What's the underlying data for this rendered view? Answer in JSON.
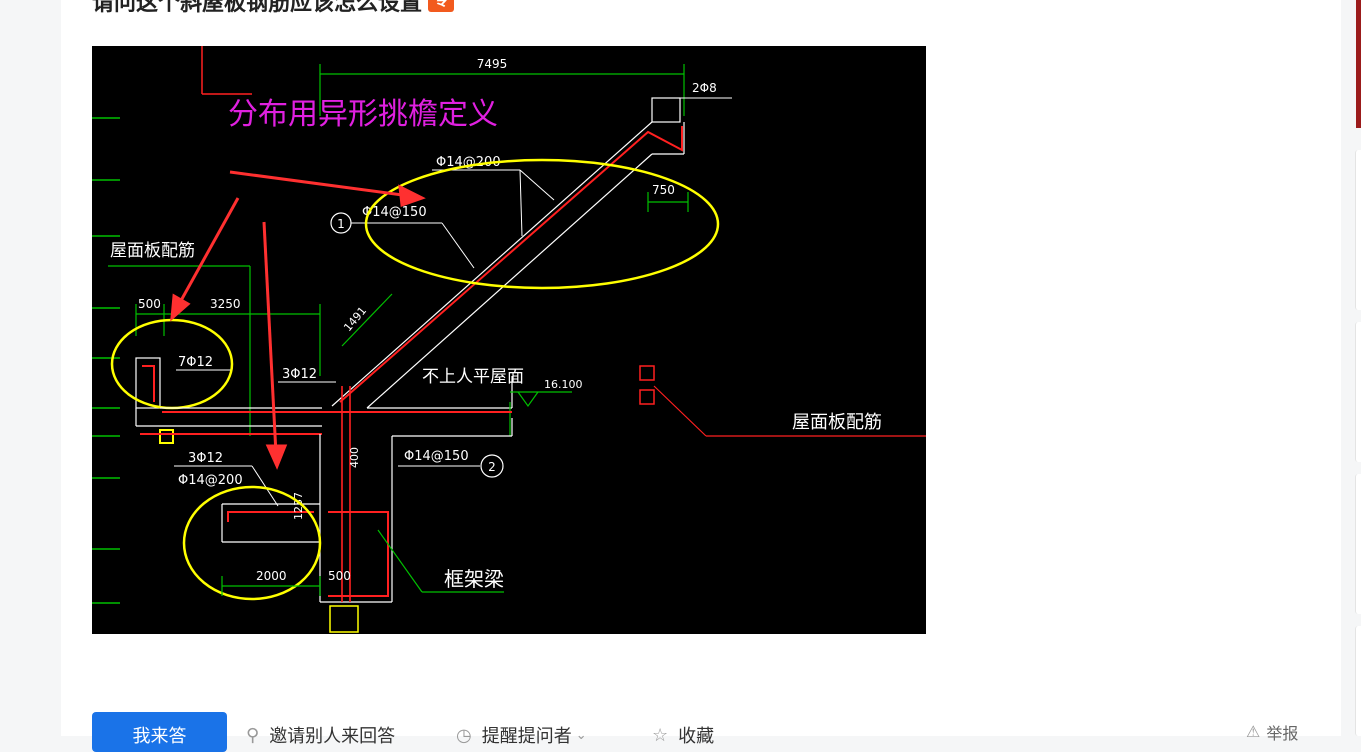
{
  "question": {
    "title": "请问这个斜屋板钢筋应该怎么设置",
    "badge": "专"
  },
  "image": {
    "annotation_title": "分布用异形挑檐定义",
    "dims": {
      "top_span": "7495",
      "top_right": "2Φ8",
      "rebar_top": "Φ14@200",
      "rebar_slope": "Φ14@150",
      "dim_750": "750",
      "roof_label_left": "屋面板配筋",
      "dim_500_left": "500",
      "dim_3250": "3250",
      "dim_1491": "1491",
      "rebar_7phi12": "7Φ12",
      "rebar_3phi12_mid": "3Φ12",
      "flat_roof_label": "不上人平屋面",
      "elevation": "16.100",
      "roof_label_right": "屋面板配筋",
      "rebar_3phi12_low": "3Φ12",
      "rebar_phi14_200_low": "Φ14@200",
      "rebar_phi14_150_low": "Φ14@150",
      "dim_1237": "1237",
      "dim_400": "400",
      "dim_2000": "2000",
      "dim_500_bottom": "500",
      "frame_beam_label": "框架梁",
      "circle_1": "1",
      "circle_2": "2"
    }
  },
  "actions": {
    "answer_label": "我来答",
    "invite_label": "邀请别人来回答",
    "remind_label": "提醒提问者",
    "collect_label": "收藏",
    "report_label": "举报"
  },
  "colors": {
    "primary": "#1a73e8",
    "badge": "#f25a1e",
    "cad_bg": "#000000",
    "cad_red": "#ff2020",
    "cad_green": "#00c000",
    "cad_yellow": "#ffff00",
    "cad_magenta": "#e020e0"
  }
}
